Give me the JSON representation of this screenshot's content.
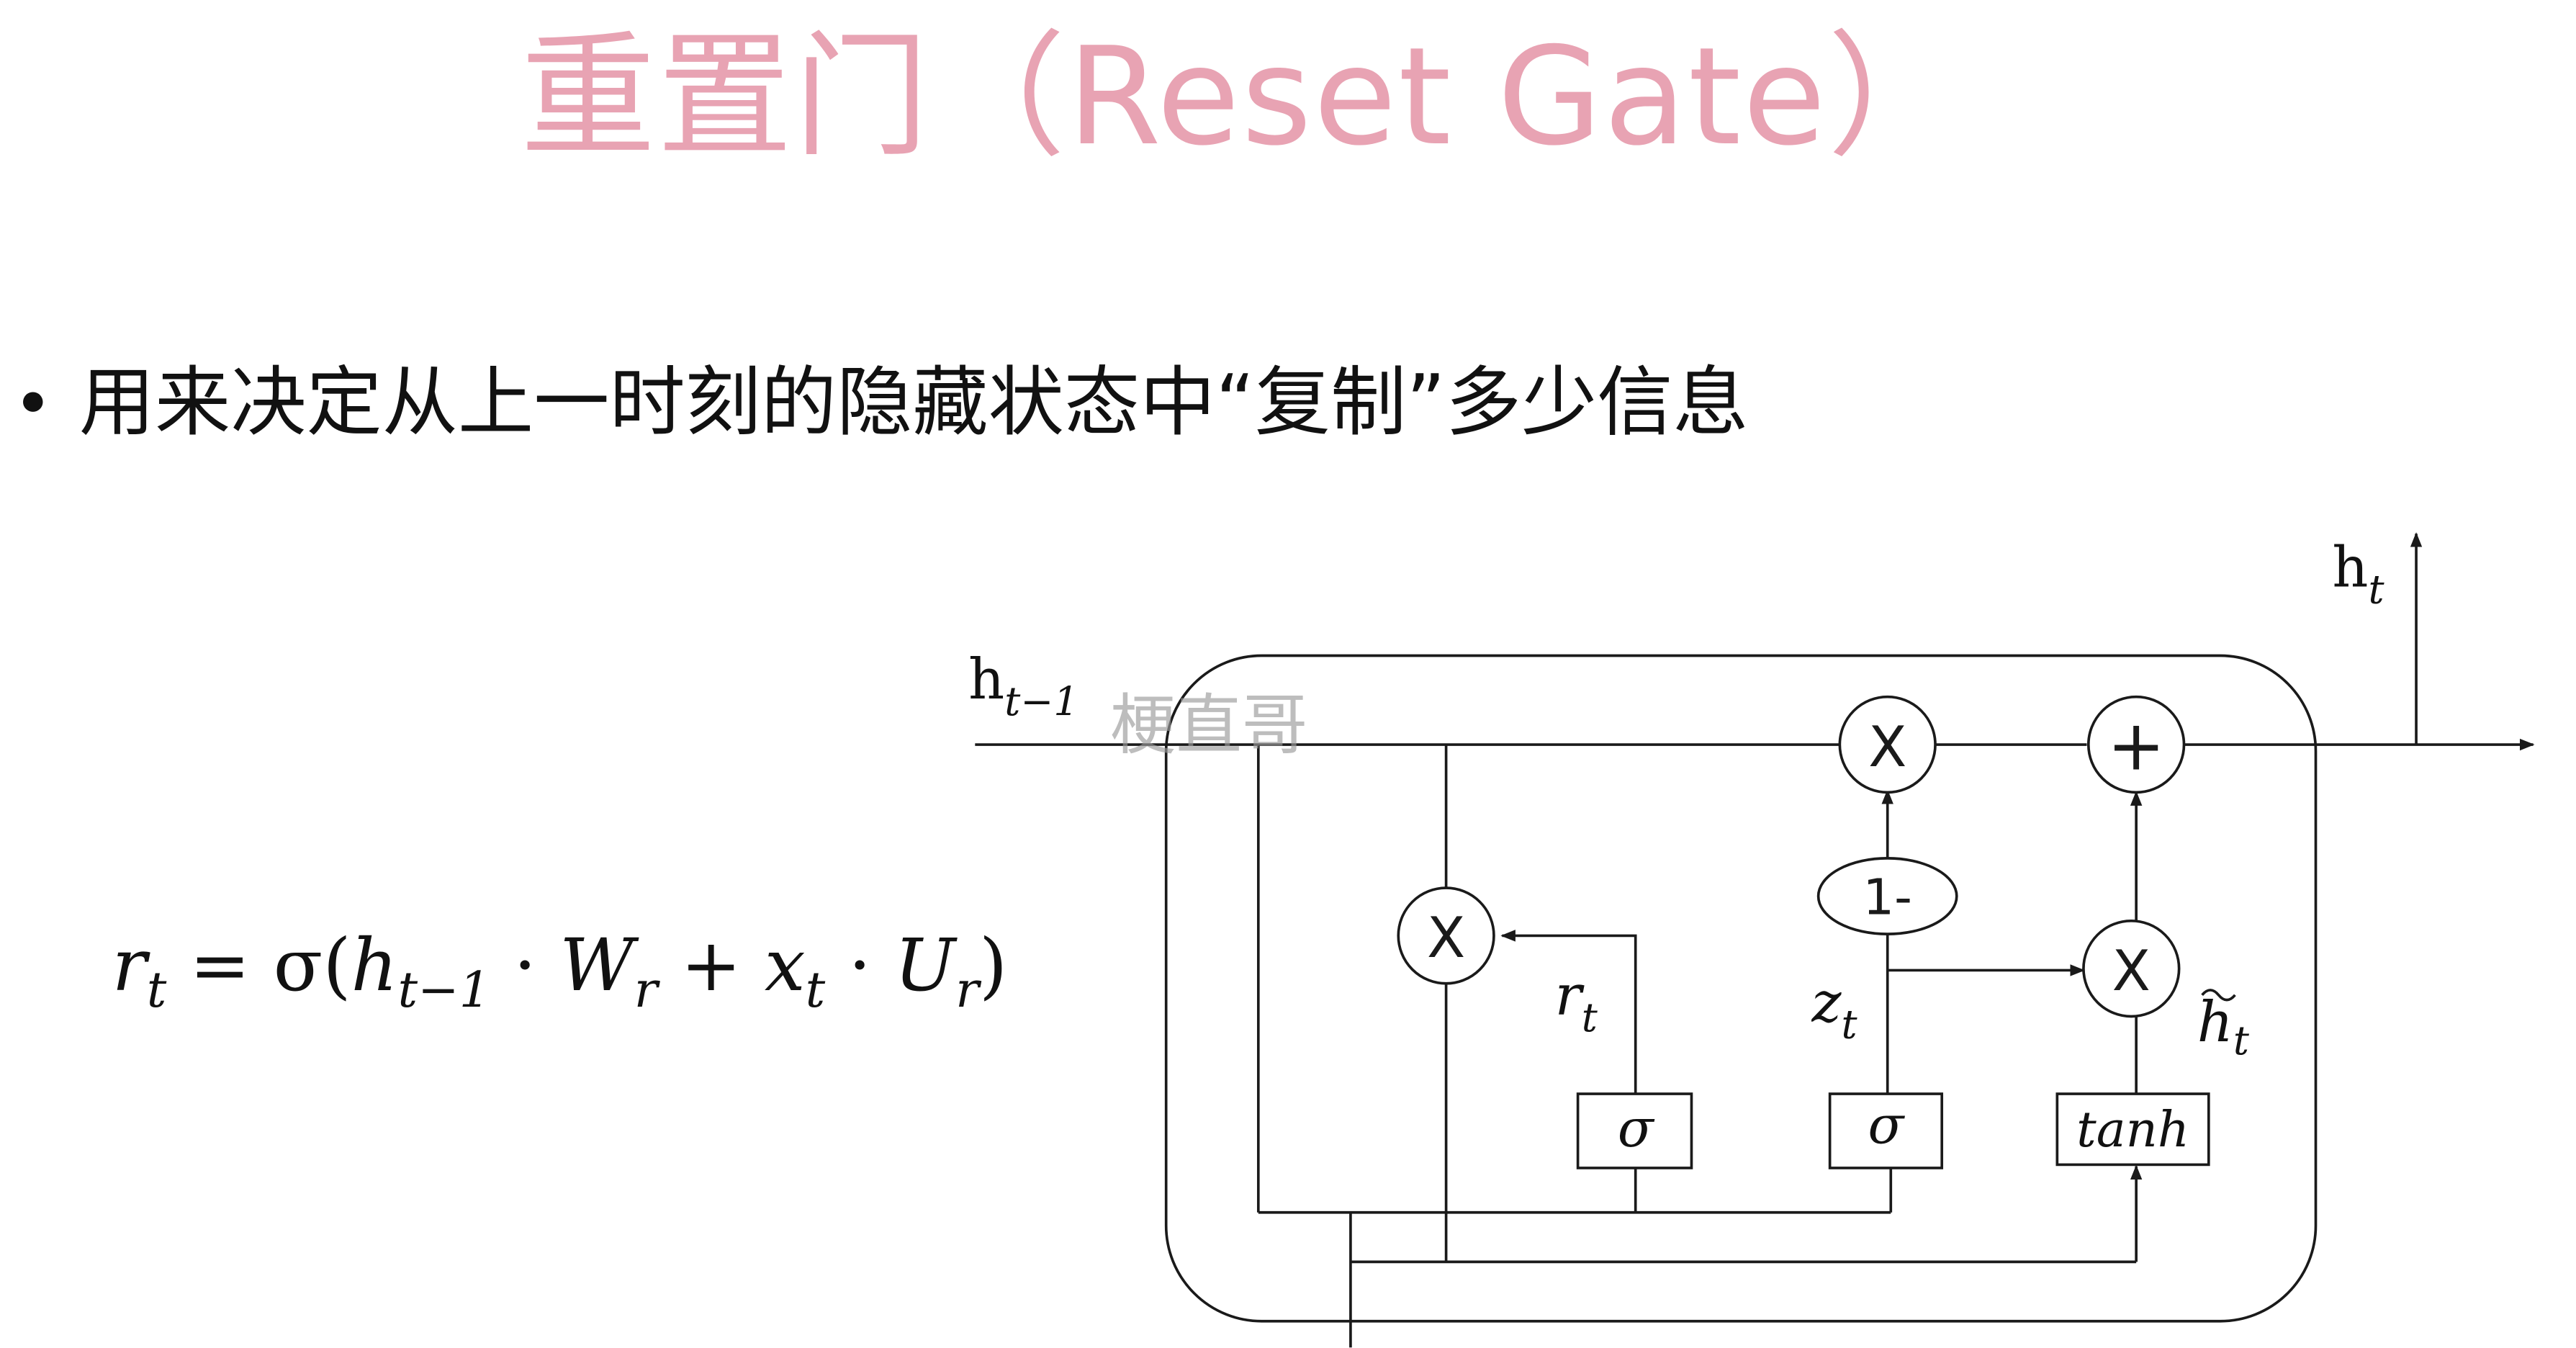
{
  "title": "重置门（Reset Gate）",
  "bullet": "用来决定从上一时刻的隐藏状态中“复制”多少信息",
  "formula": {
    "r": "r",
    "r_sub": "t",
    "eq": " = σ(",
    "h": "h",
    "h_sub": "t−1",
    "dot1": " · ",
    "W": "W",
    "W_sub": "r",
    "plus": " + ",
    "x": "x",
    "x_sub": "t",
    "dot2": " · ",
    "U": "U",
    "U_sub": "r",
    "close": ")"
  },
  "diagram": {
    "h_prev_label": "h",
    "h_prev_sub": "t−1",
    "h_out_label": "h",
    "h_out_sub": "t",
    "watermark": "梗直哥",
    "mult_symbol": "X",
    "plus_symbol": "+",
    "one_minus": "1-",
    "r_label": "r",
    "r_sub": "t",
    "z_label": "z",
    "z_sub": "t",
    "htilde_label": "h",
    "htilde_sub": "t",
    "sigma1": "σ",
    "sigma2": "σ",
    "tanh": "tanh"
  },
  "colors": {
    "title": "#e8a3b3",
    "text": "#111111",
    "line": "#1a1a1a",
    "watermark": "#9a9a9a"
  }
}
